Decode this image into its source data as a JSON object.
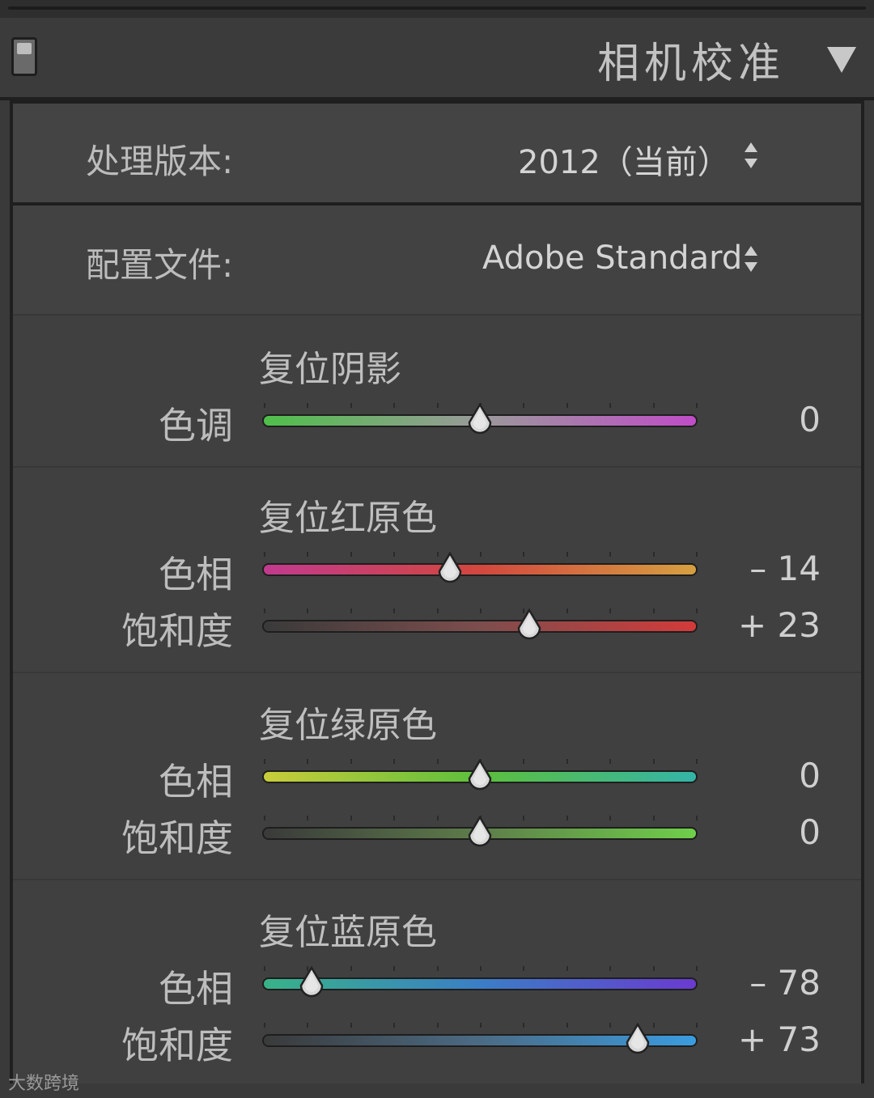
{
  "header": {
    "title": "相机校准"
  },
  "process": {
    "label": "处理版本:",
    "value": "2012（当前）"
  },
  "profile": {
    "label": "配置文件:",
    "value": "Adobe Standard"
  },
  "sections": [
    {
      "title": "复位阴影",
      "sliders": [
        {
          "label": "色调",
          "value_text": "0",
          "value": 0,
          "gradient": [
            "#4fbf4a",
            "#9a9a9a",
            "#c04cc8"
          ]
        }
      ]
    },
    {
      "title": "复位红原色",
      "sliders": [
        {
          "label": "色相",
          "value_text": "– 14",
          "value": -14,
          "gradient": [
            "#c23a8e",
            "#d2473e",
            "#d6a040"
          ]
        },
        {
          "label": "饱和度",
          "value_text": "+ 23",
          "value": 23,
          "gradient": [
            "#3a3a3a",
            "#7d4d4d",
            "#d33a3a"
          ]
        }
      ]
    },
    {
      "title": "复位绿原色",
      "sliders": [
        {
          "label": "色相",
          "value_text": "0",
          "value": 0,
          "gradient": [
            "#c9cc3a",
            "#5cbf3c",
            "#34b4a8"
          ]
        },
        {
          "label": "饱和度",
          "value_text": "0",
          "value": 0,
          "gradient": [
            "#3a3a3a",
            "#5e7d4a",
            "#6fd04a"
          ]
        }
      ]
    },
    {
      "title": "复位蓝原色",
      "sliders": [
        {
          "label": "色相",
          "value_text": "– 78",
          "value": -78,
          "gradient": [
            "#38b388",
            "#3a7ec6",
            "#6a3ad0"
          ]
        },
        {
          "label": "饱和度",
          "value_text": "+ 73",
          "value": 73,
          "gradient": [
            "#3a3a3a",
            "#4b6b85",
            "#3a9ce0"
          ]
        }
      ]
    }
  ],
  "watermark": "大数跨境"
}
